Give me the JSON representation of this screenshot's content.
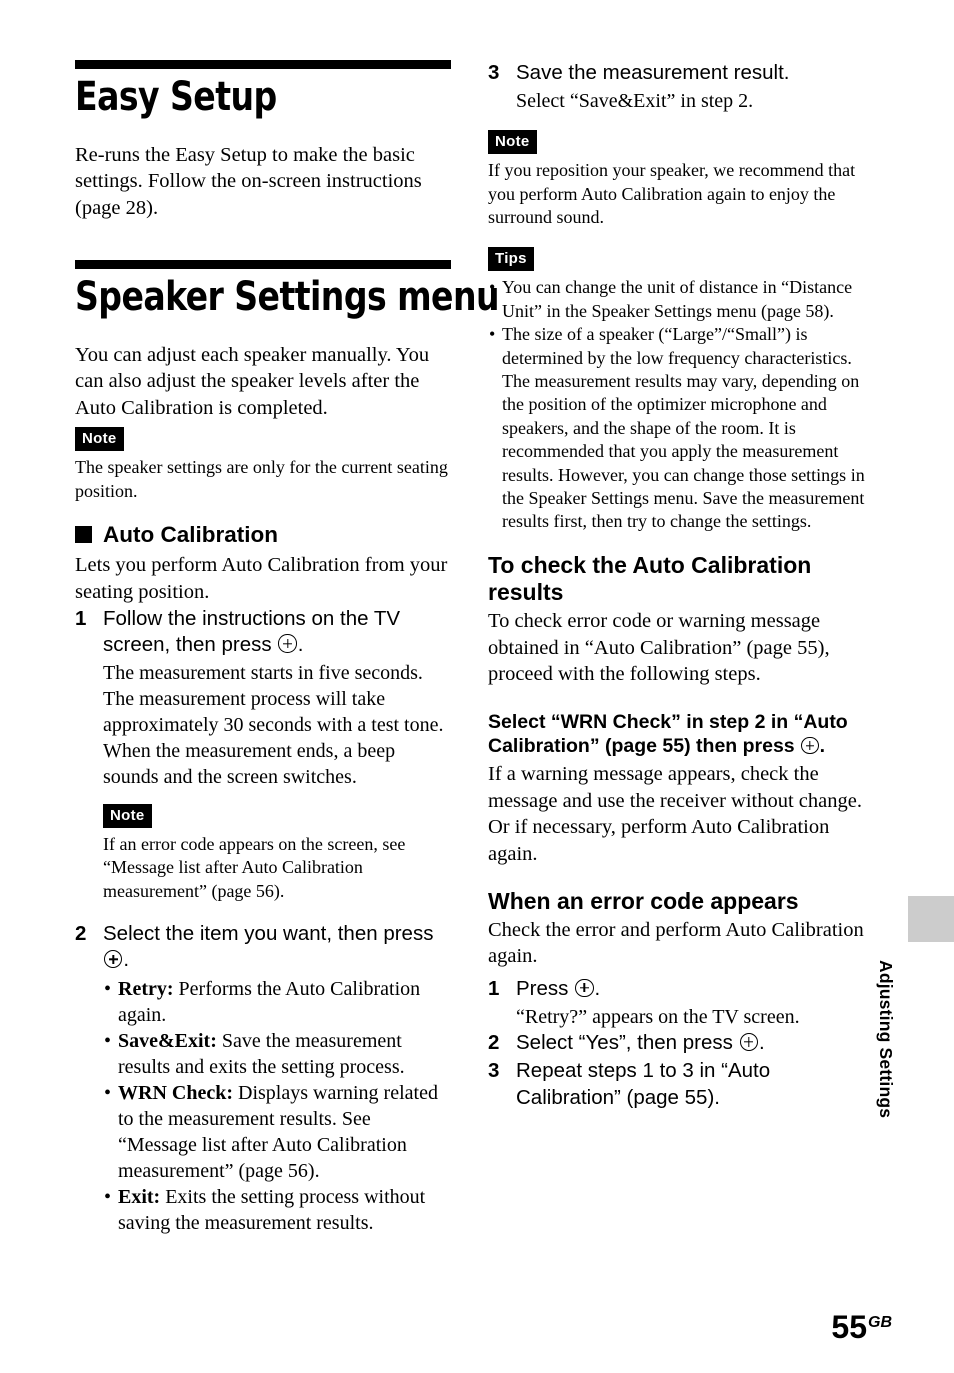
{
  "page": {
    "number": "55",
    "region_code": "GB",
    "side_tab_label": "Adjusting Settings",
    "side_tab_color": "#cccccc"
  },
  "left_column": {
    "section1": {
      "heading": "Easy Setup",
      "body": "Re-runs the Easy Setup to make the basic settings. Follow the on-screen instructions (page 28)."
    },
    "section2": {
      "heading": "Speaker Settings menu",
      "body": "You can adjust each speaker manually. You can also adjust the speaker levels after the Auto Calibration is completed.",
      "note_badge": "Note",
      "note_text": "The speaker settings are only for the current seating position."
    },
    "auto_calibration": {
      "heading": "Auto Calibration",
      "intro": "Lets you perform Auto Calibration from your seating position.",
      "step1": {
        "num": "1",
        "head_before": "Follow the instructions on the TV screen, then press ",
        "head_after": ".",
        "body": "The measurement starts in five seconds. The measurement process will take approximately 30 seconds with a test tone.\nWhen the measurement ends, a beep sounds and the screen switches."
      },
      "note_badge": "Note",
      "note_text": "If an error code appears on the screen, see “Message list after Auto Calibration measurement” (page 56).",
      "step2": {
        "num": "2",
        "head_before": "Select the item you want, then press ",
        "head_after": ".",
        "options": [
          {
            "term": "Retry:",
            "desc": " Performs the Auto Calibration again."
          },
          {
            "term": "Save&Exit:",
            "desc": " Save the measurement results and exits the setting process."
          },
          {
            "term": "WRN Check:",
            "desc": " Displays warning related to the measurement results. See “Message list after Auto Calibration measurement” (page 56)."
          },
          {
            "term": "Exit:",
            "desc": " Exits the setting process without saving the measurement results."
          }
        ]
      }
    }
  },
  "right_column": {
    "step3": {
      "num": "3",
      "head": "Save the measurement result.",
      "body": "Select “Save&Exit” in step 2."
    },
    "note_badge": "Note",
    "note_text": "If you reposition your speaker, we recommend that you perform Auto Calibration again to enjoy the surround sound.",
    "tips_badge": "Tips",
    "tips": [
      "You can change the unit of distance in “Distance Unit” in the Speaker Settings menu (page 58).",
      "The size of a speaker (“Large”/“Small”) is determined by the low frequency characteristics. The measurement results may vary, depending on the position of the optimizer microphone and speakers, and the shape of the room. It is recommended that you apply the measurement results. However, you can change those settings in the Speaker Settings menu. Save the measurement results first, then try to change the settings."
    ],
    "check_results": {
      "heading": "To check the Auto Calibration results",
      "body": "To check error code or warning message obtained in “Auto Calibration” (page 55), proceed with the following steps.",
      "sub_heading_before": "Select “WRN Check” in step 2 in “Auto Calibration” (page 55) then press ",
      "sub_heading_after": ".",
      "sub_body": "If a warning message appears, check the message and use the receiver without change.\nOr if necessary, perform Auto Calibration again."
    },
    "error_code": {
      "heading": "When an error code appears",
      "body": "Check the error and perform Auto Calibration again.",
      "steps": [
        {
          "num": "1",
          "head_before": "Press ",
          "head_after": ".",
          "sub": "“Retry?” appears on the TV screen."
        },
        {
          "num": "2",
          "head_before": "Select “Yes”, then press ",
          "head_after": ".",
          "sub": ""
        },
        {
          "num": "3",
          "head_before": "Repeat steps 1 to 3 in “Auto Calibration” (page 55).",
          "head_after": "",
          "sub": ""
        }
      ]
    }
  }
}
